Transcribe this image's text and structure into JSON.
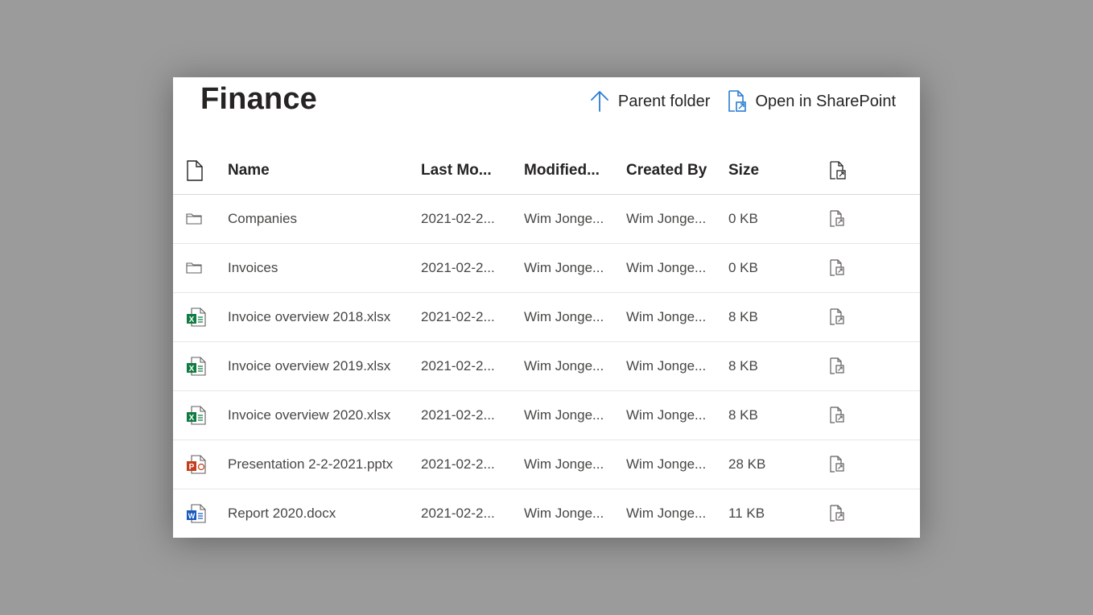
{
  "title": "Finance",
  "actions": {
    "parent_folder": "Parent folder",
    "open_in_sharepoint": "Open in SharePoint"
  },
  "columns": {
    "icon": "file-icon",
    "name": "Name",
    "last_modified": "Last Mo...",
    "modified_by": "Modified...",
    "created_by": "Created By",
    "size": "Size",
    "open": "open-in-sharepoint-icon"
  },
  "rows": [
    {
      "icon": "folder-icon",
      "name": "Companies",
      "last_modified": "2021-02-2...",
      "modified_by": "Wim Jonge...",
      "created_by": "Wim Jonge...",
      "size": "0 KB"
    },
    {
      "icon": "folder-icon",
      "name": "Invoices",
      "last_modified": "2021-02-2...",
      "modified_by": "Wim Jonge...",
      "created_by": "Wim Jonge...",
      "size": "0 KB"
    },
    {
      "icon": "excel-icon",
      "name": "Invoice overview 2018.xlsx",
      "last_modified": "2021-02-2...",
      "modified_by": "Wim Jonge...",
      "created_by": "Wim Jonge...",
      "size": "8 KB"
    },
    {
      "icon": "excel-icon",
      "name": "Invoice overview 2019.xlsx",
      "last_modified": "2021-02-2...",
      "modified_by": "Wim Jonge...",
      "created_by": "Wim Jonge...",
      "size": "8 KB"
    },
    {
      "icon": "excel-icon",
      "name": "Invoice overview 2020.xlsx",
      "last_modified": "2021-02-2...",
      "modified_by": "Wim Jonge...",
      "created_by": "Wim Jonge...",
      "size": "8 KB"
    },
    {
      "icon": "powerpoint-icon",
      "name": "Presentation 2-2-2021.pptx",
      "last_modified": "2021-02-2...",
      "modified_by": "Wim Jonge...",
      "created_by": "Wim Jonge...",
      "size": "28 KB"
    },
    {
      "icon": "word-icon",
      "name": "Report 2020.docx",
      "last_modified": "2021-02-2...",
      "modified_by": "Wim Jonge...",
      "created_by": "Wim Jonge...",
      "size": "11 KB"
    }
  ],
  "colors": {
    "accent": "#2b7cd3",
    "excel": "#107c41",
    "powerpoint": "#c43e1c",
    "word": "#185abd",
    "text": "#252423",
    "muted": "#484644"
  }
}
